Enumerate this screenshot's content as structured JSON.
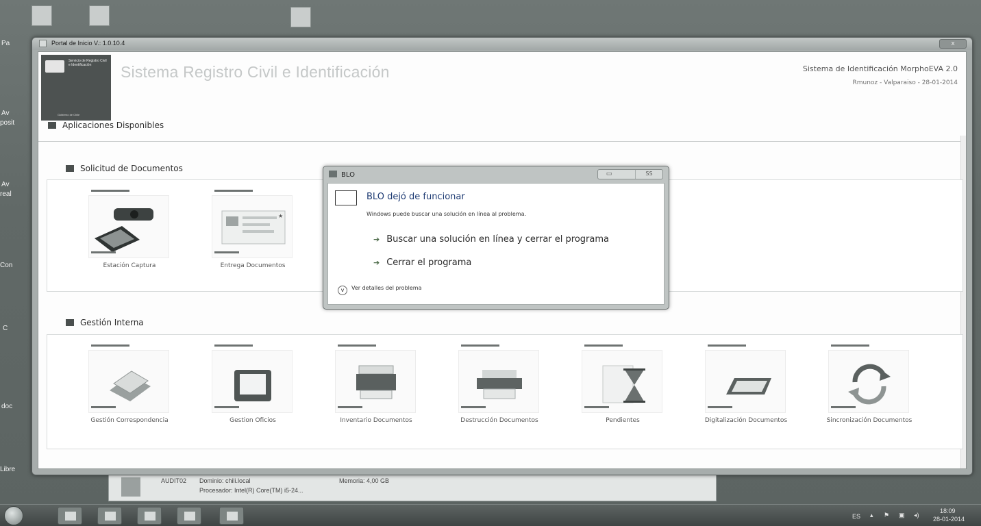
{
  "desktop": {
    "icons": [
      {
        "name": "recycle-bin-icon",
        "label": "Pa"
      },
      {
        "name": "folder-icon",
        "label": ""
      },
      {
        "name": "document-icon",
        "label": ""
      },
      {
        "name": "shortcut-icon-1",
        "label": "Av"
      },
      {
        "name": "shortcut-icon-2",
        "label": "posit"
      },
      {
        "name": "shortcut-icon-3",
        "label": "Av"
      },
      {
        "name": "shortcut-icon-4",
        "label": "real"
      },
      {
        "name": "shortcut-icon-5",
        "label": "Con"
      },
      {
        "name": "shortcut-icon-6",
        "label": "C"
      },
      {
        "name": "shortcut-icon-7",
        "label": "doc"
      },
      {
        "name": "shortcut-icon-8",
        "label": "Libre"
      }
    ]
  },
  "window": {
    "title": "Portal de Inicio V.: 1.0.10.4",
    "close_label": "x"
  },
  "logo": {
    "institution": "Servicio de Registro Civil e Identificación",
    "government": "Gobierno de Chile"
  },
  "header": {
    "app_title": "Sistema Registro Civil e Identificación",
    "system_name": "Sistema de Identificación MorphoEVA 2.0",
    "user_line": "Rmunoz - Valparaiso - 28-01-2014"
  },
  "sections": {
    "available": "Aplicaciones Disponibles",
    "requests": "Solicitud de Documentos",
    "internal": "Gestión Interna"
  },
  "request_apps": [
    {
      "label": "Estación Captura",
      "icon": "camera-signature-pad-icon"
    },
    {
      "label": "Entrega Documentos",
      "icon": "id-card-icon"
    }
  ],
  "internal_apps": [
    {
      "label": "Gestión Correspondencia",
      "icon": "envelopes-icon"
    },
    {
      "label": "Gestion Oficios",
      "icon": "inbox-tray-icon"
    },
    {
      "label": "Inventario Documentos",
      "icon": "printer-icon"
    },
    {
      "label": "Destrucción Documentos",
      "icon": "shredder-icon"
    },
    {
      "label": "Pendientes",
      "icon": "hourglass-icon"
    },
    {
      "label": "Digitalización Documentos",
      "icon": "scanner-icon"
    },
    {
      "label": "Sincronización Documentos",
      "icon": "sync-arrows-icon"
    }
  ],
  "error_dialog": {
    "title": "BLO",
    "minimize": "▭",
    "close": "SS",
    "heading": "BLO dejó de funcionar",
    "subtext": "Windows puede buscar una solución en línea al problema.",
    "option1": "Buscar una solución en línea y cerrar el programa",
    "option2": "Cerrar el programa",
    "details": "Ver detalles del problema"
  },
  "sysinfo": {
    "computer": "AUDIT02",
    "domain": "Dominio: chili.local",
    "memory": "Memoria: 4,00 GB",
    "processor": "Procesador: Intel(R) Core(TM) i5-24..."
  },
  "taskbar": {
    "lang": "ES",
    "time": "18:09",
    "date": "28-01-2014"
  }
}
